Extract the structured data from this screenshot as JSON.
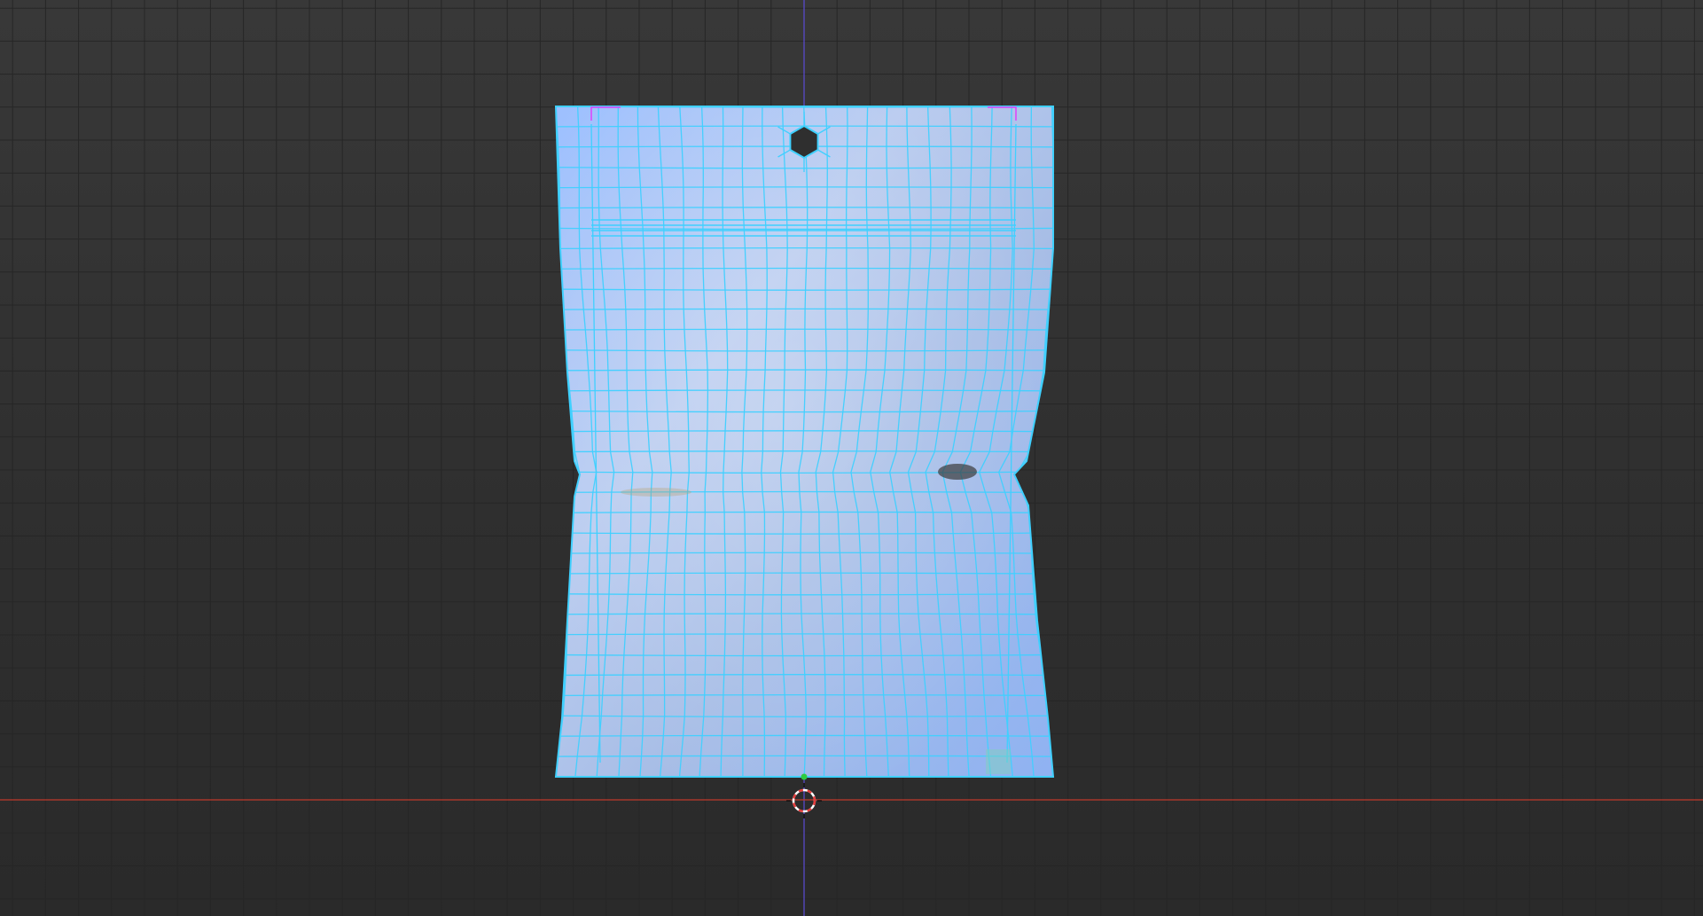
{
  "viewport": {
    "view": "front-orthographic",
    "background_color": "#333333",
    "grid_line_color": "#262626",
    "x_axis_color": "#c0392b",
    "z_axis_color": "#5b4bd6"
  },
  "object": {
    "name_icon": "pouch-mesh",
    "selected": true,
    "shading": "solid-with-wireframe-overlay",
    "face_color": "#8fb2f2",
    "wire_color": "#3fd0ff",
    "hang_hole_icon": "hexagon-hole"
  },
  "markers": {
    "origin_color": "#2ecc40",
    "cursor_3d_icon": "crosshair-3d-cursor",
    "cursor_ring_colors": [
      "#e33b3b",
      "#ffffff"
    ]
  }
}
